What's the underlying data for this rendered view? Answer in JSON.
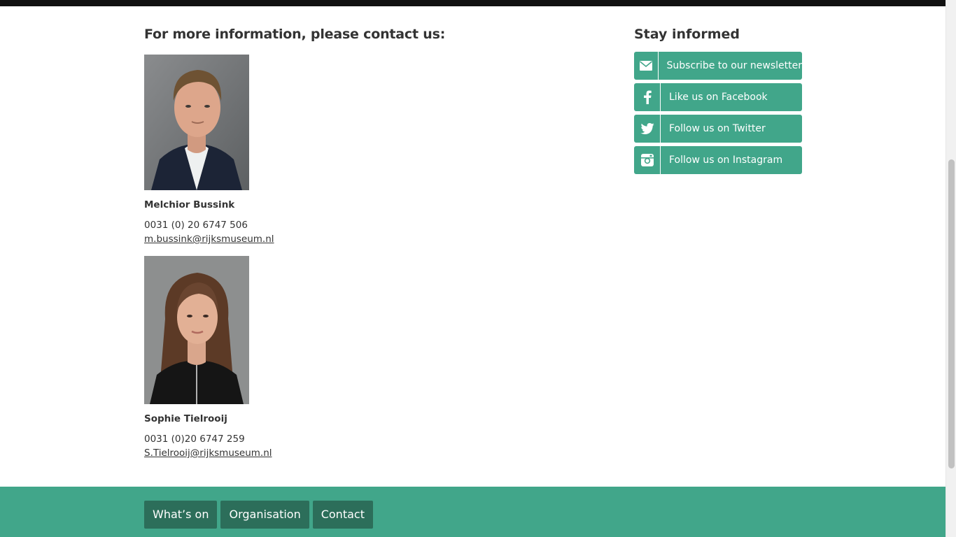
{
  "contact": {
    "heading": "For more information, please contact us:",
    "people": [
      {
        "name": "Melchior Bussink",
        "phone": "0031 (0) 20 6747 506",
        "email": "m.bussink@rijksmuseum.nl"
      },
      {
        "name": "Sophie Tielrooij",
        "phone": "0031 (0)20 6747 259",
        "email": "S.Tielrooij@rijksmuseum.nl"
      }
    ]
  },
  "stay_informed": {
    "heading": "Stay informed",
    "buttons": [
      {
        "label": "Subscribe to our newsletter",
        "icon": "envelope-icon"
      },
      {
        "label": "Like us on Facebook",
        "icon": "facebook-icon"
      },
      {
        "label": "Follow us on Twitter",
        "icon": "twitter-icon"
      },
      {
        "label": "Follow us on Instagram",
        "icon": "instagram-icon"
      }
    ]
  },
  "footer": {
    "nav": [
      {
        "label": "What’s on"
      },
      {
        "label": "Organisation"
      },
      {
        "label": "Contact"
      }
    ]
  },
  "colors": {
    "accent": "#41a68a",
    "footer_button": "#2c6e5a",
    "text": "#333333",
    "top_bar": "#111111"
  }
}
